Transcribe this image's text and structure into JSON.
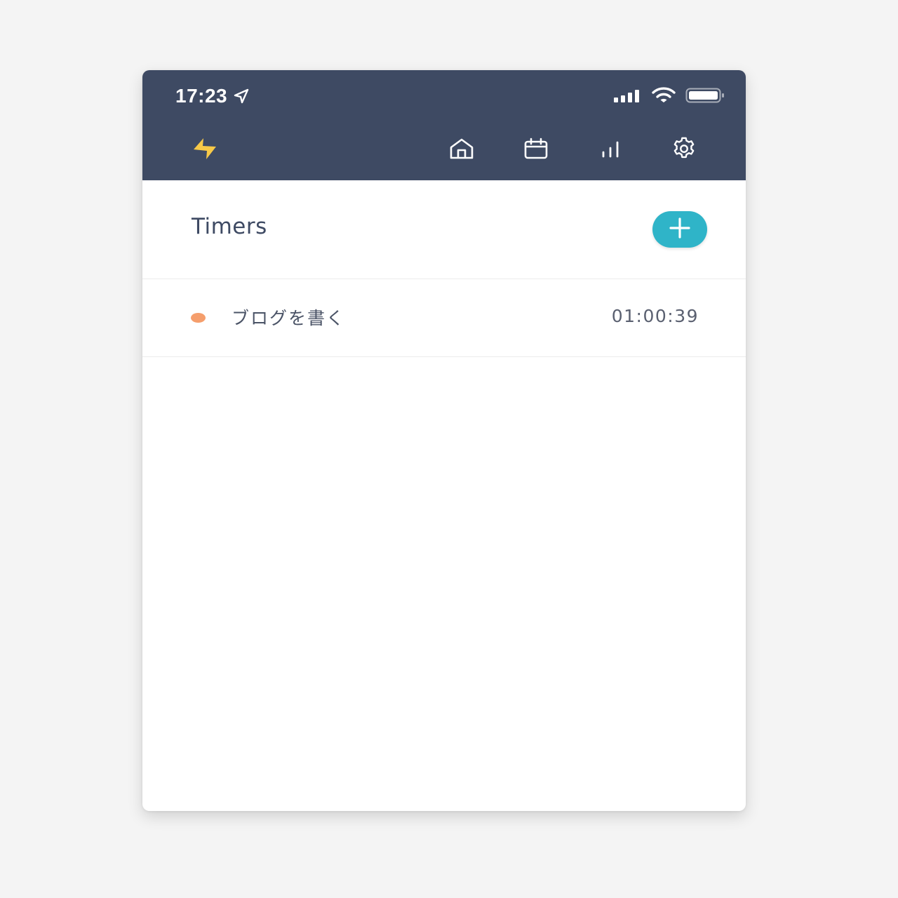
{
  "status_bar": {
    "time": "17:23",
    "location_icon": "location-arrow-icon",
    "signal_icon": "cellular-signal-icon",
    "wifi_icon": "wifi-icon",
    "battery_icon": "battery-icon"
  },
  "nav": {
    "logo_icon": "lightning-bolt-icon",
    "items": [
      {
        "id": "home",
        "icon": "home-icon"
      },
      {
        "id": "calendar",
        "icon": "calendar-icon"
      },
      {
        "id": "stats",
        "icon": "bar-chart-icon"
      },
      {
        "id": "settings",
        "icon": "gear-icon"
      }
    ]
  },
  "page": {
    "title": "Timers",
    "add_icon": "plus-icon"
  },
  "timers": [
    {
      "name": "ブログを書く",
      "elapsed": "01:00:39",
      "color": "#f59e6c"
    }
  ],
  "colors": {
    "topbar": "#3e4a63",
    "accent": "#2fb4c8",
    "logo": "#f7c948",
    "title": "#3e4a63"
  }
}
